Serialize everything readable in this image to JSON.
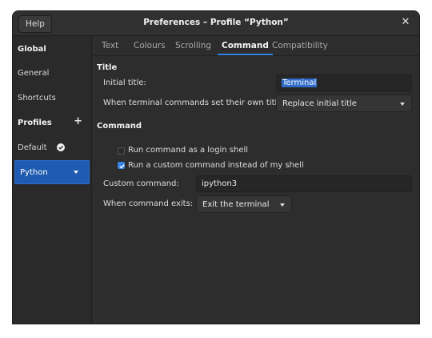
{
  "window": {
    "title": "Preferences – Profile “Python”",
    "help_label": "Help",
    "close_glyph": "✕"
  },
  "sidebar": {
    "global": "Global",
    "general": "General",
    "shortcuts": "Shortcuts",
    "profiles": "Profiles",
    "add_glyph": "+",
    "default": "Default",
    "python": "Python"
  },
  "tabs": [
    "Text",
    "Colours",
    "Scrolling",
    "Command",
    "Compatibility"
  ],
  "active_tab": "Command",
  "title_section": {
    "heading": "Title",
    "initial_title_label": "Initial title:",
    "initial_title_value": "Terminal",
    "when_label": "When terminal commands set their own titles:",
    "when_value": "Replace initial title"
  },
  "command_section": {
    "heading": "Command",
    "login_shell_label": "Run command as a login shell",
    "login_shell_checked": false,
    "custom_label": "Run a custom command instead of my shell",
    "custom_checked": true,
    "custom_command_label": "Custom command:",
    "custom_command_value": "ipython3",
    "exit_label": "When command exits:",
    "exit_value": "Exit the terminal"
  },
  "colors": {
    "accent": "#3584e4",
    "selected_row": "#1f5bb0",
    "window_bg": "#2d2d2d"
  }
}
